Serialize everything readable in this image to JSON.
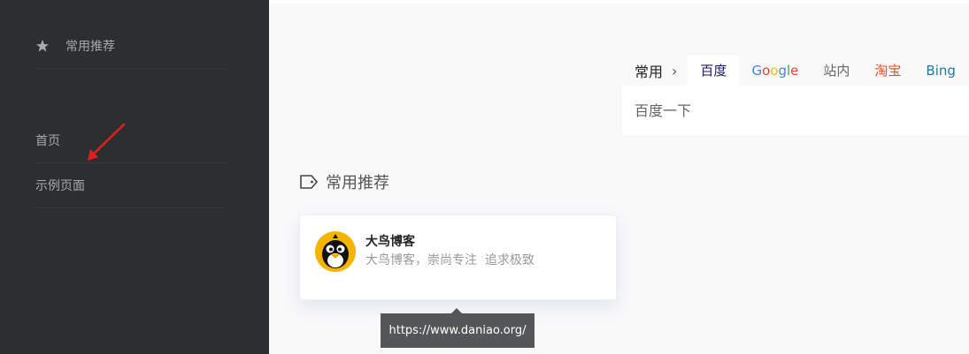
{
  "sidebar": {
    "items": [
      {
        "label": "常用推荐",
        "icon": "star-icon"
      },
      {
        "label": "首页"
      },
      {
        "label": "示例页面"
      }
    ]
  },
  "search": {
    "group_label": "常用",
    "chevron": "›",
    "tabs": [
      "百度",
      "Google",
      "站内",
      "淘宝",
      "Bing"
    ],
    "active_tab": "百度",
    "placeholder": "百度一下"
  },
  "section": {
    "title": "常用推荐",
    "icon": "tag-icon"
  },
  "card": {
    "title": "大鸟博客",
    "description": "大鸟博客，崇尚专注  追求极致",
    "avatar_icon": "penguin-avatar-icon"
  },
  "tooltip": {
    "text": "https://www.daniao.org/"
  },
  "colors": {
    "sidebar_bg": "#2c2e2f",
    "sidebar_text": "#a6a8ab",
    "arrow": "#e02020",
    "taobao": "#e5511d",
    "bing": "#1c7aa8",
    "active_tab": "#1a1a6e",
    "tooltip_bg": "#555658"
  }
}
